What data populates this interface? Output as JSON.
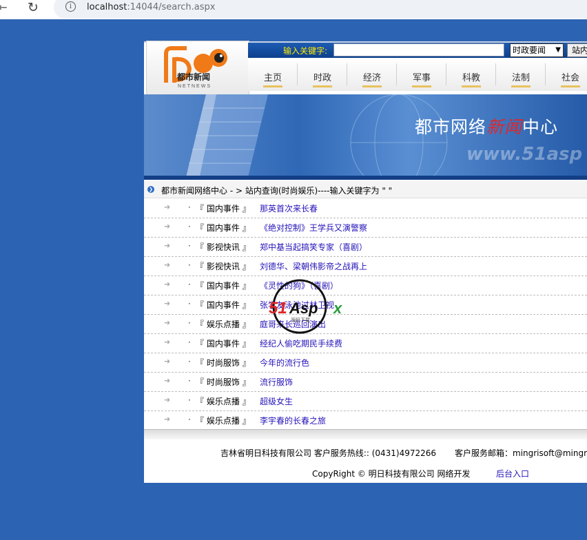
{
  "browser": {
    "url_host": "localhost",
    "url_rest": ":14044/search.aspx"
  },
  "logo": {
    "cn_text": "都市新闻",
    "en_text": "NETNEWS"
  },
  "search": {
    "label": "输入关键字:",
    "input_value": "",
    "select_value": "时政要闻",
    "button_label": "站内"
  },
  "nav": {
    "items": [
      {
        "label": "主页"
      },
      {
        "label": "时政"
      },
      {
        "label": "经济"
      },
      {
        "label": "军事"
      },
      {
        "label": "科教"
      },
      {
        "label": "法制"
      },
      {
        "label": "社会"
      }
    ]
  },
  "banner": {
    "title_pre": "都市网络",
    "title_red": "新闻",
    "title_post": "中心",
    "url_text": "www.51asp"
  },
  "breadcrumb": {
    "text": "都市新闻网络中心 - > 站内查询(时尚娱乐)----输入关键字为 \" \""
  },
  "results": [
    {
      "category": "『 国内事件 』",
      "title": "那英首次来长春"
    },
    {
      "category": "『 国内事件 』",
      "title": "《绝对控制》王学兵又演警察"
    },
    {
      "category": "『 影视快讯 』",
      "title": "郑中基当起搞笑专家（喜剧）"
    },
    {
      "category": "『 影视快讯 』",
      "title": "刘德华、梁朝伟影帝之战再上"
    },
    {
      "category": "『 国内事件 』",
      "title": "《灵性的狗》（喜剧）"
    },
    {
      "category": "『 国内事件 』",
      "title": "张学友泳池过林卫视"
    },
    {
      "category": "『 娱乐点播 』",
      "title": "庭哥来长巡回演出"
    },
    {
      "category": "『 国内事件 』",
      "title": "经纪人偷吃期民手续费"
    },
    {
      "category": "『 时尚服饰 』",
      "title": "今年的流行色"
    },
    {
      "category": "『 时尚服饰 』",
      "title": "流行服饰"
    },
    {
      "category": "『 娱乐点播 』",
      "title": "超级女生"
    },
    {
      "category": "『 娱乐点播 』",
      "title": "李宇春的长春之旅"
    }
  ],
  "footer": {
    "company_line": "吉林省明日科技有限公司 客户服务热线::   (0431)4972266",
    "email_line": "客户服务邮箱：mingrisoft@mingri",
    "copyright": "CopyRight ©  明日科技有限公司 网络开发",
    "admin_link": "后台入口"
  },
  "watermark": {
    "text": "51Aspx",
    "sub": "源码下载"
  },
  "colors": {
    "background": "#2d63b3",
    "link": "#2414b8",
    "accent_red": "#e0262a",
    "logo_orange": "#f07a18"
  }
}
